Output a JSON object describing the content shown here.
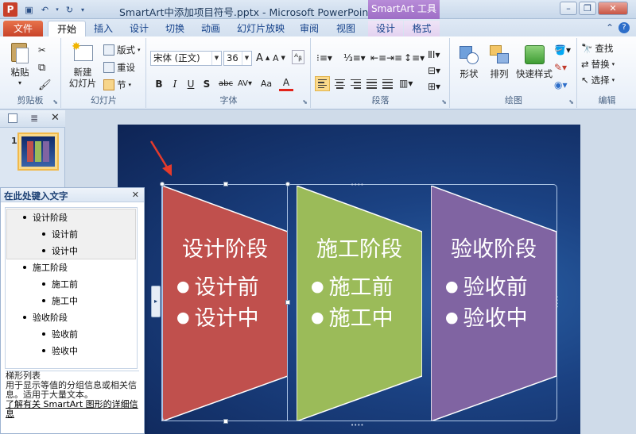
{
  "window": {
    "title": "SmartArt中添加项目符号.pptx - Microsoft PowerPoint",
    "app_logo": "P",
    "context_group": "SmartArt 工具",
    "controls": [
      "minimize-icon",
      "restore-icon",
      "close-icon"
    ]
  },
  "tabs": [
    "文件",
    "开始",
    "插入",
    "设计",
    "切换",
    "动画",
    "幻灯片放映",
    "审阅",
    "视图",
    "设计",
    "格式"
  ],
  "ribbon": {
    "clipboard": {
      "paste": "粘贴",
      "label": "剪贴板"
    },
    "slides": {
      "new_slide": "新建\n幻灯片",
      "layout": "版式",
      "reset": "重设",
      "section": "节",
      "label": "幻灯片"
    },
    "font": {
      "name": "宋体 (正文)",
      "size": "36",
      "label": "字体",
      "bold": "B",
      "italic": "I",
      "underline": "U",
      "shadow": "S",
      "strike": "abc",
      "case": "Aa",
      "color": "A"
    },
    "paragraph": {
      "label": "段落"
    },
    "drawing": {
      "shape": "形状",
      "arrange": "排列",
      "quick_styles": "快速样式",
      "label": "绘图"
    },
    "editing": {
      "find": "查找",
      "replace": "替换",
      "select": "选择",
      "label": "编辑"
    }
  },
  "slides_panel": {
    "thumb_number": "1"
  },
  "smartart": {
    "shapes": [
      {
        "title": "设计阶段",
        "bullets": [
          "设计前",
          "设计中"
        ],
        "color": "#c0504d"
      },
      {
        "title": "施工阶段",
        "bullets": [
          "施工前",
          "施工中"
        ],
        "color": "#9bbb59"
      },
      {
        "title": "验收阶段",
        "bullets": [
          "验收前",
          "验收中"
        ],
        "color": "#8064a2"
      }
    ],
    "bullet_char": "●"
  },
  "text_pane": {
    "title": "在此处键入文字",
    "items": [
      {
        "level": 1,
        "text": "设计阶段"
      },
      {
        "level": 2,
        "text": "设计前"
      },
      {
        "level": 2,
        "text": "设计中"
      },
      {
        "level": 1,
        "text": "施工阶段"
      },
      {
        "level": 2,
        "text": "施工前"
      },
      {
        "level": 2,
        "text": "施工中"
      },
      {
        "level": 1,
        "text": "验收阶段"
      },
      {
        "level": 2,
        "text": "验收前"
      },
      {
        "level": 2,
        "text": "验收中"
      }
    ],
    "layout_name": "梯形列表",
    "layout_desc": "用于显示等值的分组信息或相关信息。适用于大量文本。",
    "learn_more": "了解有关 SmartArt 图形的详细信息"
  },
  "colors": {
    "annotation_arrow": "#e53b2c",
    "slide_bg": "#1b4283"
  }
}
